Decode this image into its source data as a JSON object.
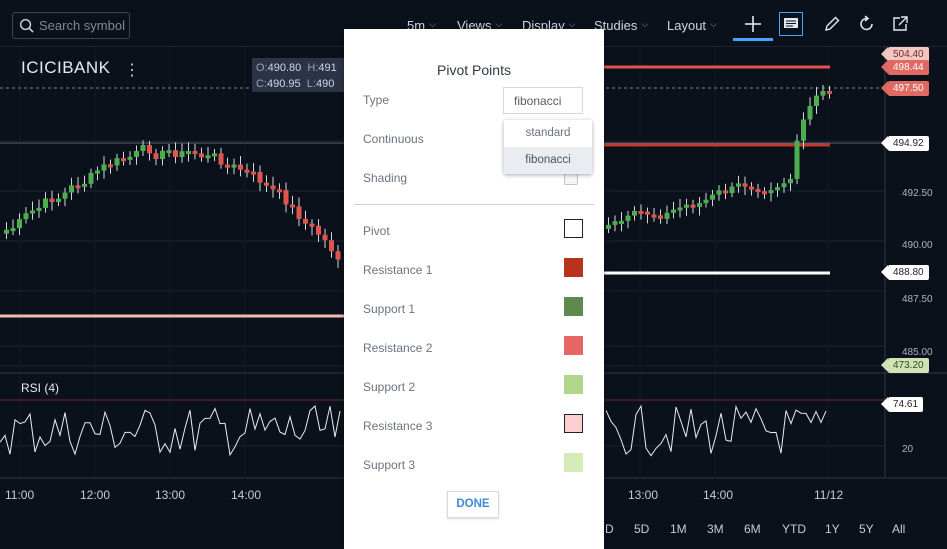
{
  "toolbar": {
    "search_placeholder": "Search symbol",
    "menus": [
      {
        "label": "5m"
      },
      {
        "label": "Views"
      },
      {
        "label": "Display"
      },
      {
        "label": "Studies"
      },
      {
        "label": "Layout"
      }
    ],
    "icons": [
      "crosshair-icon",
      "comment-icon",
      "pencil-icon",
      "undo-icon",
      "share-icon"
    ]
  },
  "chart": {
    "symbol": "ICICIBANK",
    "ohlc": {
      "o_label": "O:",
      "o": "490.80",
      "h_label": "H:",
      "h": "491",
      "c_label": "C:",
      "c": "490.95",
      "l_label": "L:",
      "l": "490"
    },
    "yticks": [
      "492.50",
      "490.00",
      "487.50",
      "485.00",
      "20"
    ],
    "price_tags": [
      {
        "value": "504.40",
        "bg": "#f1c6c4",
        "fg": "#7a2a25"
      },
      {
        "value": "498.44",
        "bg": "#e06a63",
        "fg": "#ffffff"
      },
      {
        "value": "497.50",
        "bg": "#e06a63",
        "fg": "#ffffff"
      },
      {
        "value": "494.92",
        "bg": "#ffffff",
        "fg": "#222222"
      },
      {
        "value": "488.80",
        "bg": "#ffffff",
        "fg": "#222222"
      },
      {
        "value": "473.20",
        "bg": "#cfe3b4",
        "fg": "#2f4a1e"
      },
      {
        "value": "74.61",
        "bg": "#ffffff",
        "fg": "#222222"
      }
    ],
    "rsi_label": "RSI (4)",
    "xticks": [
      "11:00",
      "12:00",
      "13:00",
      "14:00",
      "13:00",
      "14:00",
      "11/12"
    ],
    "ranges": [
      "D",
      "5D",
      "1M",
      "3M",
      "6M",
      "YTD",
      "1Y",
      "5Y",
      "All"
    ],
    "colors": {
      "up": "#4cae4c",
      "down": "#e0544d",
      "pivot_red": "#e0544d",
      "pivot_dark": "#c0392b",
      "support_pink": "#f4b9b5"
    }
  },
  "modal": {
    "title": "Pivot Points",
    "type_label": "Type",
    "type_value": "fibonacci",
    "type_options": [
      "standard",
      "fibonacci"
    ],
    "continuous_label": "Continuous",
    "shading_label": "Shading",
    "levels": [
      {
        "label": "Pivot",
        "color": "#ffffff"
      },
      {
        "label": "Resistance 1",
        "color": "#b8321c"
      },
      {
        "label": "Support 1",
        "color": "#5e8a4d"
      },
      {
        "label": "Resistance 2",
        "color": "#e66565"
      },
      {
        "label": "Support 2",
        "color": "#b2d68c"
      },
      {
        "label": "Resistance 3",
        "color": "#fbcfcf"
      },
      {
        "label": "Support 3",
        "color": "#d6ebb8"
      }
    ],
    "done_label": "DONE"
  }
}
